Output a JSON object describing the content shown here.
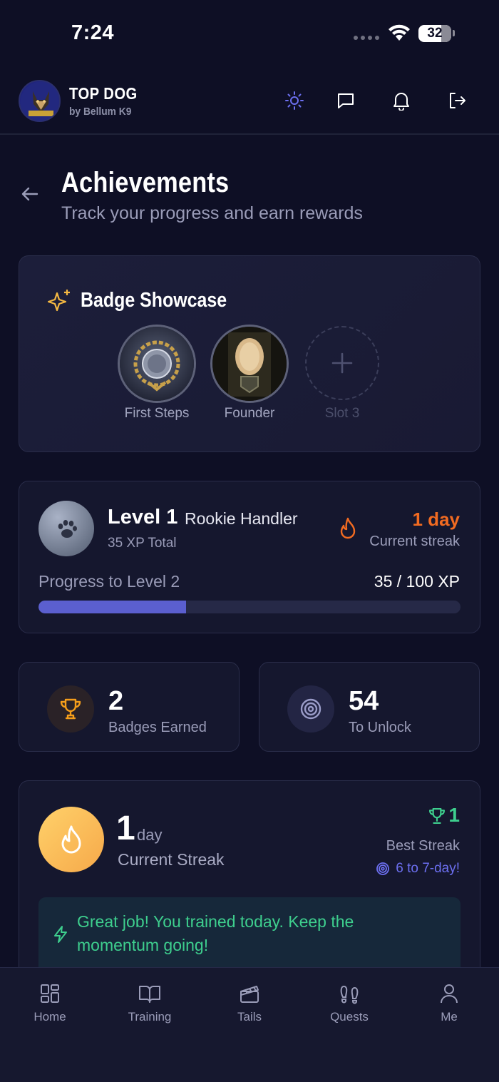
{
  "status_bar": {
    "time": "7:24",
    "battery": "32"
  },
  "header": {
    "brand_title": "TOP DOG",
    "brand_subtitle": "by Bellum K9",
    "icons": [
      "sun-icon",
      "message-icon",
      "bell-icon",
      "logout-icon"
    ]
  },
  "page": {
    "title": "Achievements",
    "subtitle": "Track your progress and earn rewards"
  },
  "showcase": {
    "title": "Badge Showcase",
    "badges": [
      {
        "label": "First Steps"
      },
      {
        "label": "Founder"
      },
      {
        "label": "Slot 3"
      }
    ]
  },
  "level": {
    "title": "Level 1",
    "rank": "Rookie Handler",
    "xp_total": "35 XP Total",
    "streak_value": "1 day",
    "streak_label": "Current streak",
    "progress_label": "Progress to Level 2",
    "progress_value": "35 / 100 XP",
    "progress_fraction": 0.35
  },
  "stats": {
    "badges_count": "2",
    "badges_label": "Badges Earned",
    "unlock_count": "54",
    "unlock_label": "To Unlock"
  },
  "streak": {
    "value": "1",
    "unit": "day",
    "label": "Current Streak",
    "best_value": "1",
    "best_label": "Best Streak",
    "next_target": "6 to 7-day!",
    "callout": "Great job! You trained today. Keep the momentum going!"
  },
  "colors": {
    "background": "#0e0f25",
    "accent": "#5b5fcf",
    "streak_orange": "#f26b21",
    "success_green": "#3ecf8e"
  },
  "nav": {
    "items": [
      {
        "label": "Home",
        "icon": "grid-icon"
      },
      {
        "label": "Training",
        "icon": "book-icon"
      },
      {
        "label": "Tails",
        "icon": "clapper-icon"
      },
      {
        "label": "Quests",
        "icon": "footprints-icon"
      },
      {
        "label": "Me",
        "icon": "user-icon"
      }
    ]
  }
}
